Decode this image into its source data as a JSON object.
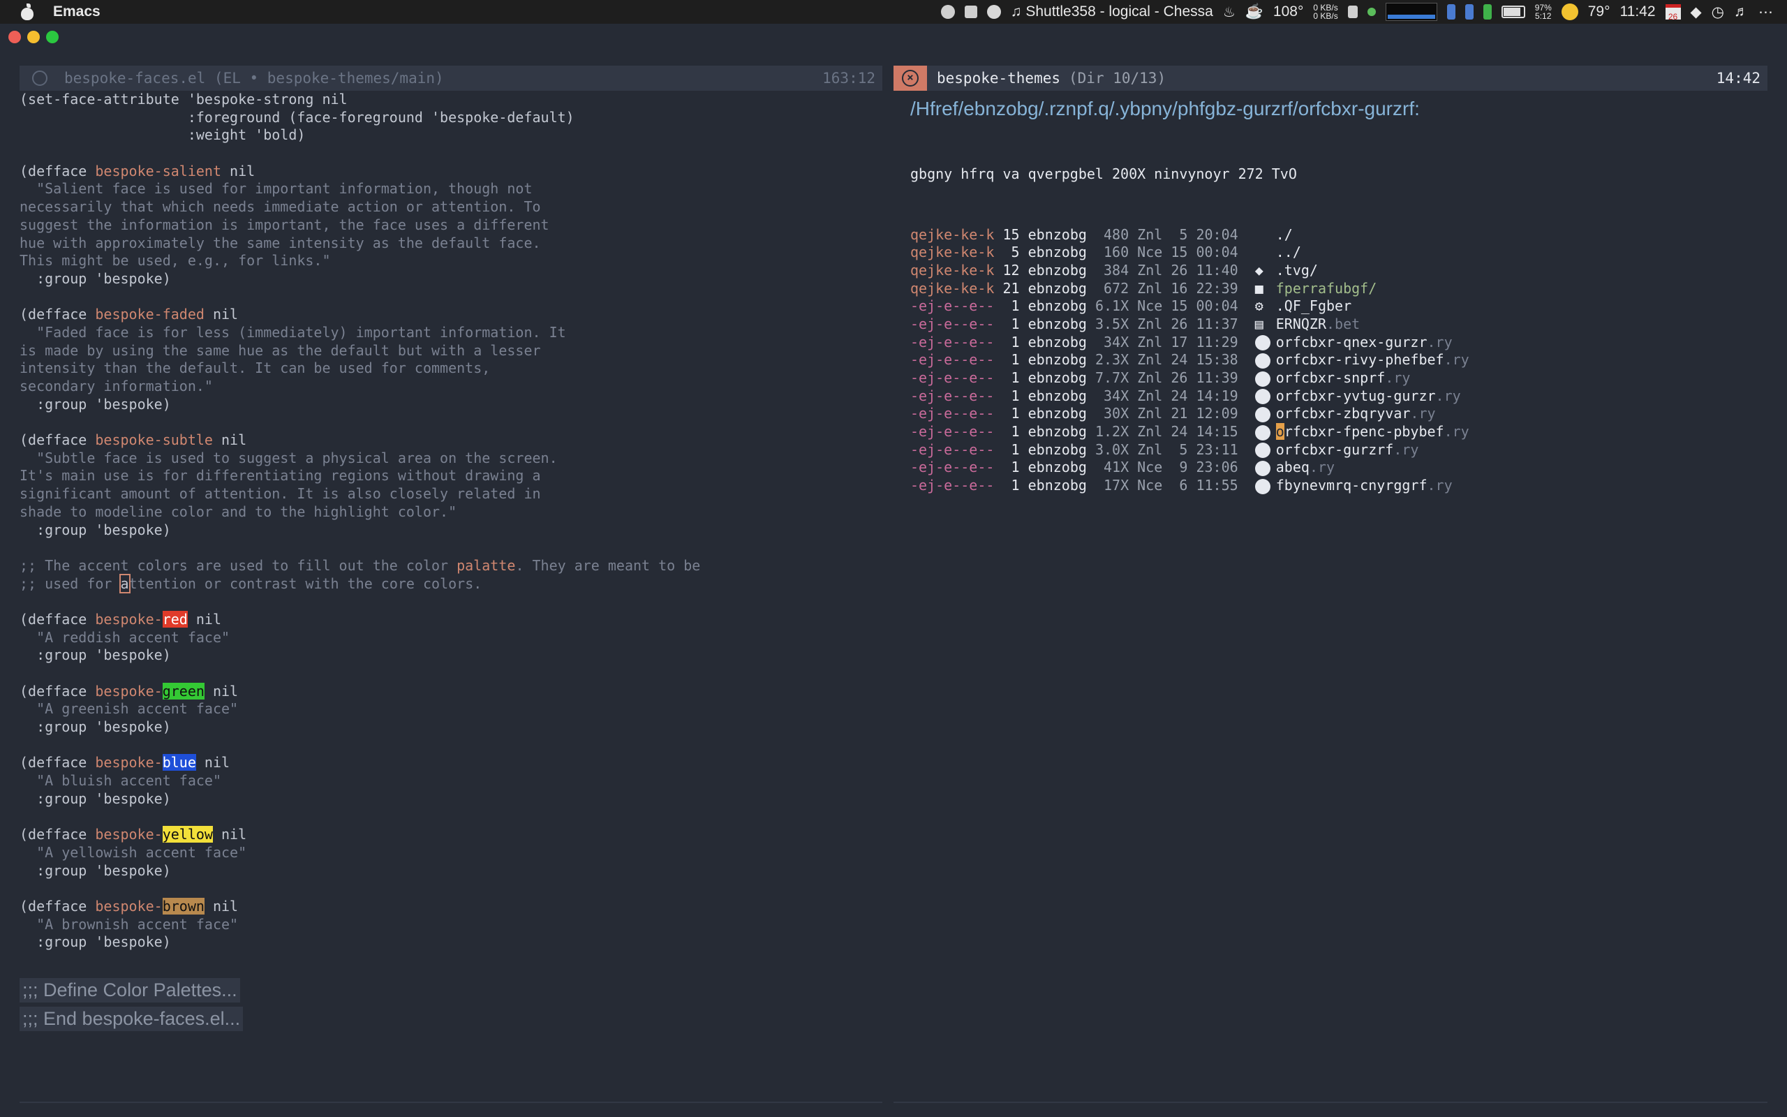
{
  "menubar": {
    "app_name": "Emacs",
    "now_playing": "♫ Shuttle358 - logical - Chessa",
    "temperature_cpu": "108°",
    "net_up": "0 KB/s",
    "net_down": "0 KB/s",
    "battery_pct": "97%",
    "battery_time": "5:12",
    "weather": "79°",
    "clock": "11:42",
    "calendar_day": "26"
  },
  "left": {
    "header_title": "bespoke-faces.el (EL • bespoke-themes/main)",
    "header_pos": "163:12",
    "folds": [
      ";;; Define Color Palettes...",
      ";;; End bespoke-faces.el..."
    ]
  },
  "right": {
    "header_name": "bespoke-themes",
    "header_info": "(Dir 10/13)",
    "header_time": "14:42",
    "path": "/Hfref/ebnzobg/.rznpf.q/.ybpny/phfgbz-gurzrf/orfcbxr-gurzrf:",
    "summary": "gbgny hfrq va qverpgbel 200X ninvynoyr 272 TvO",
    "entries": [
      {
        "perm": "qejke-ke-k",
        "n": "15",
        "owner": "ebnzobg",
        "size": " 480",
        "date": "Znl  5 20:04",
        "icon": "",
        "name": "./",
        "ext": "",
        "kind": "dir"
      },
      {
        "perm": "qejke-ke-k",
        "n": " 5",
        "owner": "ebnzobg",
        "size": " 160",
        "date": "Nce 15 00:04",
        "icon": "",
        "name": "../",
        "ext": "",
        "kind": "dir"
      },
      {
        "perm": "qejke-ke-k",
        "n": "12",
        "owner": "ebnzobg",
        "size": " 384",
        "date": "Znl 26 11:40",
        "icon": "git",
        "name": ".tvg/",
        "ext": "",
        "kind": "dir"
      },
      {
        "perm": "qejke-ke-k",
        "n": "21",
        "owner": "ebnzobg",
        "size": " 672",
        "date": "Znl 16 22:39",
        "icon": "folder",
        "name": "fperrafubgf/",
        "ext": "",
        "kind": "dir"
      },
      {
        "perm": "-ej-e--e--",
        "n": " 1",
        "owner": "ebnzobg",
        "size": "6.1X",
        "date": "Nce 15 00:04",
        "icon": "gear",
        "name": ".QF_Fgber",
        "ext": "",
        "kind": "file"
      },
      {
        "perm": "-ej-e--e--",
        "n": " 1",
        "owner": "ebnzobg",
        "size": "3.5X",
        "date": "Znl 26 11:37",
        "icon": "doc",
        "name": "ERNQZR",
        "ext": ".bet",
        "kind": "file"
      },
      {
        "perm": "-ej-e--e--",
        "n": " 1",
        "owner": "ebnzobg",
        "size": " 34X",
        "date": "Znl 17 11:29",
        "icon": "el",
        "name": "orfcbxr-qnex-gurzr",
        "ext": ".ry",
        "kind": "file"
      },
      {
        "perm": "-ej-e--e--",
        "n": " 1",
        "owner": "ebnzobg",
        "size": "2.3X",
        "date": "Znl 24 15:38",
        "icon": "el",
        "name": "orfcbxr-rivy-phefbef",
        "ext": ".ry",
        "kind": "file"
      },
      {
        "perm": "-ej-e--e--",
        "n": " 1",
        "owner": "ebnzobg",
        "size": "7.7X",
        "date": "Znl 26 11:39",
        "icon": "el",
        "name": "orfcbxr-snprf",
        "ext": ".ry",
        "kind": "file"
      },
      {
        "perm": "-ej-e--e--",
        "n": " 1",
        "owner": "ebnzobg",
        "size": " 34X",
        "date": "Znl 24 14:19",
        "icon": "el",
        "name": "orfcbxr-yvtug-gurzr",
        "ext": ".ry",
        "kind": "file"
      },
      {
        "perm": "-ej-e--e--",
        "n": " 1",
        "owner": "ebnzobg",
        "size": " 30X",
        "date": "Znl 21 12:09",
        "icon": "el",
        "name": "orfcbxr-zbqryvar",
        "ext": ".ry",
        "kind": "file"
      },
      {
        "perm": "-ej-e--e--",
        "n": " 1",
        "owner": "ebnzobg",
        "size": "1.2X",
        "date": "Znl 24 14:15",
        "icon": "el",
        "name": "orfcbxr-fpenc-pbybef",
        "ext": ".ry",
        "kind": "file",
        "cursor": true
      },
      {
        "perm": "-ej-e--e--",
        "n": " 1",
        "owner": "ebnzobg",
        "size": "3.0X",
        "date": "Znl  5 23:11",
        "icon": "el",
        "name": "orfcbxr-gurzrf",
        "ext": ".ry",
        "kind": "file"
      },
      {
        "perm": "-ej-e--e--",
        "n": " 1",
        "owner": "ebnzobg",
        "size": " 41X",
        "date": "Nce  9 23:06",
        "icon": "el",
        "name": "abeq",
        "ext": ".ry",
        "kind": "file"
      },
      {
        "perm": "-ej-e--e--",
        "n": " 1",
        "owner": "ebnzobg",
        "size": " 17X",
        "date": "Nce  6 11:55",
        "icon": "el",
        "name": "fbynevmrq-cnyrggrf",
        "ext": ".ry",
        "kind": "file"
      }
    ]
  },
  "code_lines": [
    [
      [
        "t",
        "(set-face-attribute 'bespoke-strong nil"
      ]
    ],
    [
      [
        "t",
        "                    :foreground (face-foreground 'bespoke-default)"
      ]
    ],
    [
      [
        "t",
        "                    :weight 'bold)"
      ]
    ],
    [],
    [
      [
        "t",
        "("
      ],
      [
        "kw",
        "defface"
      ],
      [
        "t",
        " "
      ],
      [
        "fn",
        "bespoke-salient"
      ],
      [
        "t",
        " nil"
      ]
    ],
    [
      [
        "doc",
        "  \"Salient face is used for important information, though not"
      ]
    ],
    [
      [
        "doc",
        "necessarily that which needs immediate action or attention. To"
      ]
    ],
    [
      [
        "doc",
        "suggest the information is important, the face uses a different"
      ]
    ],
    [
      [
        "doc",
        "hue with approximately the same intensity as the default face."
      ]
    ],
    [
      [
        "doc",
        "This might be used, e.g., for links.\""
      ]
    ],
    [
      [
        "t",
        "  :group 'bespoke)"
      ]
    ],
    [],
    [
      [
        "t",
        "("
      ],
      [
        "kw",
        "defface"
      ],
      [
        "t",
        " "
      ],
      [
        "fn",
        "bespoke-faded"
      ],
      [
        "t",
        " nil"
      ]
    ],
    [
      [
        "doc",
        "  \"Faded face is for less (immediately) important information. It"
      ]
    ],
    [
      [
        "doc",
        "is made by using the same hue as the default but with a lesser"
      ]
    ],
    [
      [
        "doc",
        "intensity than the default. It can be used for comments,"
      ]
    ],
    [
      [
        "doc",
        "secondary information.\""
      ]
    ],
    [
      [
        "t",
        "  :group 'bespoke)"
      ]
    ],
    [],
    [
      [
        "t",
        "("
      ],
      [
        "kw",
        "defface"
      ],
      [
        "t",
        " "
      ],
      [
        "fn",
        "bespoke-subtle"
      ],
      [
        "t",
        " nil"
      ]
    ],
    [
      [
        "doc",
        "  \"Subtle face is used to suggest a physical area on the screen."
      ]
    ],
    [
      [
        "doc",
        "It's main use is for differentiating regions without drawing a"
      ]
    ],
    [
      [
        "doc",
        "significant amount of attention. It is also closely related in"
      ]
    ],
    [
      [
        "doc",
        "shade to modeline color and to the highlight color.\""
      ]
    ],
    [
      [
        "t",
        "  :group 'bespoke)"
      ]
    ],
    [],
    [
      [
        "com",
        ";; The accent colors are used to fill out the color "
      ],
      [
        "pal",
        "palatte"
      ],
      [
        "com",
        ". They are meant to be"
      ]
    ],
    [
      [
        "com",
        ";; used for "
      ],
      [
        "cur",
        "a"
      ],
      [
        "com",
        "ttention or contrast with the core colors."
      ]
    ],
    [],
    [
      [
        "t",
        "("
      ],
      [
        "kw",
        "defface"
      ],
      [
        "t",
        " "
      ],
      [
        "fn",
        "bespoke-"
      ],
      [
        "red",
        "red"
      ],
      [
        "t",
        " nil"
      ]
    ],
    [
      [
        "doc",
        "  \"A reddish accent face\""
      ]
    ],
    [
      [
        "t",
        "  :group 'bespoke)"
      ]
    ],
    [],
    [
      [
        "t",
        "("
      ],
      [
        "kw",
        "defface"
      ],
      [
        "t",
        " "
      ],
      [
        "fn",
        "bespoke-"
      ],
      [
        "green",
        "green"
      ],
      [
        "t",
        " nil"
      ]
    ],
    [
      [
        "doc",
        "  \"A greenish accent face\""
      ]
    ],
    [
      [
        "t",
        "  :group 'bespoke)"
      ]
    ],
    [],
    [
      [
        "t",
        "("
      ],
      [
        "kw",
        "defface"
      ],
      [
        "t",
        " "
      ],
      [
        "fn",
        "bespoke-"
      ],
      [
        "blue",
        "blue"
      ],
      [
        "t",
        " nil"
      ]
    ],
    [
      [
        "doc",
        "  \"A bluish accent face\""
      ]
    ],
    [
      [
        "t",
        "  :group 'bespoke)"
      ]
    ],
    [],
    [
      [
        "t",
        "("
      ],
      [
        "kw",
        "defface"
      ],
      [
        "t",
        " "
      ],
      [
        "fn",
        "bespoke-"
      ],
      [
        "yellow",
        "yellow"
      ],
      [
        "t",
        " nil"
      ]
    ],
    [
      [
        "doc",
        "  \"A yellowish accent face\""
      ]
    ],
    [
      [
        "t",
        "  :group 'bespoke)"
      ]
    ],
    [],
    [
      [
        "t",
        "("
      ],
      [
        "kw",
        "defface"
      ],
      [
        "t",
        " "
      ],
      [
        "fn",
        "bespoke-"
      ],
      [
        "brown",
        "brown"
      ],
      [
        "t",
        " nil"
      ]
    ],
    [
      [
        "doc",
        "  \"A brownish accent face\""
      ]
    ],
    [
      [
        "t",
        "  :group 'bespoke)"
      ]
    ]
  ]
}
